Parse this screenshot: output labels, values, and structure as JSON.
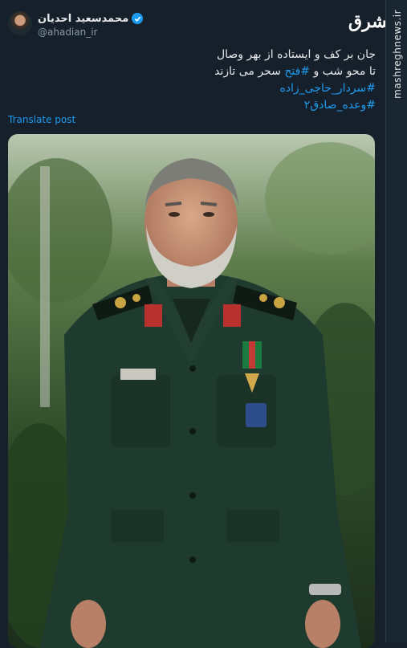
{
  "user": {
    "display_name": "محمدسعید احدیان",
    "handle": "@ahadian_ir",
    "avatar_icon": "user-avatar"
  },
  "tweet": {
    "line1": "جان بر کف و ایستاده از بهر وصال",
    "line2_prefix": "تا محو شب و ",
    "line2_hashtag": "#فتح",
    "line2_suffix": " سحر می تازند",
    "hashtag1": "#سردار_حاجی_زاده",
    "hashtag2": "#وعده_صادق۲"
  },
  "translate_label": "Translate post",
  "watermark": {
    "logo_text": "مشرق",
    "url": "mashreghnews.ir"
  },
  "colors": {
    "background": "#15202b",
    "link": "#1d9bf0",
    "text": "#e7e9ea",
    "muted": "#8b98a5"
  }
}
